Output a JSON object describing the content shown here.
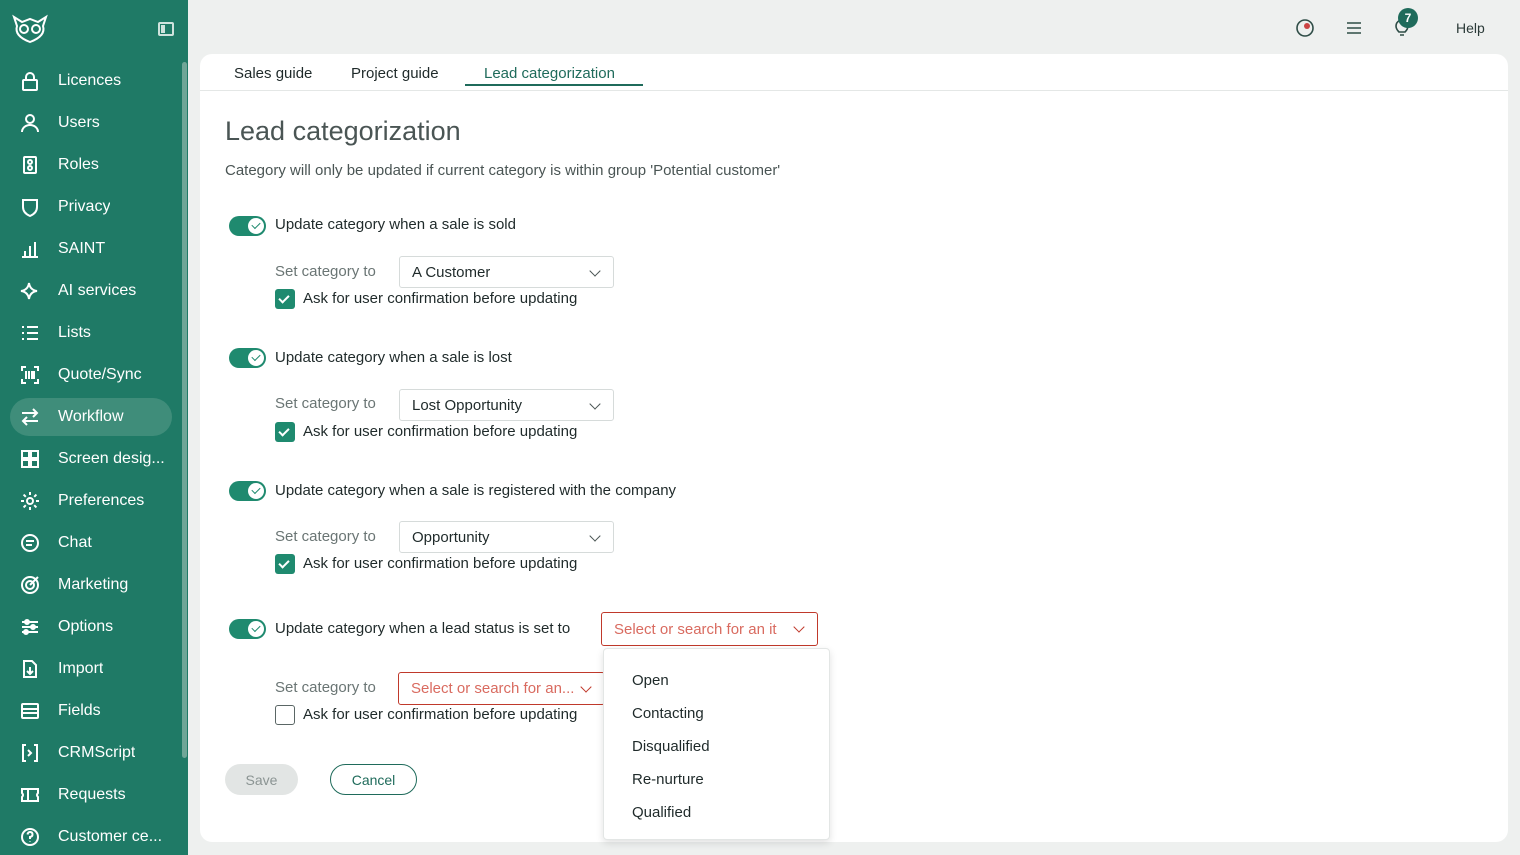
{
  "sidebar": {
    "items": [
      {
        "label": "Licences",
        "icon": "lock-icon"
      },
      {
        "label": "Users",
        "icon": "user-icon"
      },
      {
        "label": "Roles",
        "icon": "roles-icon"
      },
      {
        "label": "Privacy",
        "icon": "shield-icon"
      },
      {
        "label": "SAINT",
        "icon": "bar-chart-icon"
      },
      {
        "label": "AI services",
        "icon": "sparkle-icon"
      },
      {
        "label": "Lists",
        "icon": "list-icon"
      },
      {
        "label": "Quote/Sync",
        "icon": "barcode-icon"
      },
      {
        "label": "Workflow",
        "icon": "arrows-icon",
        "active": true
      },
      {
        "label": "Screen desig...",
        "icon": "grid-icon"
      },
      {
        "label": "Preferences",
        "icon": "gear-icon"
      },
      {
        "label": "Chat",
        "icon": "chat-icon"
      },
      {
        "label": "Marketing",
        "icon": "target-icon"
      },
      {
        "label": "Options",
        "icon": "sliders-icon"
      },
      {
        "label": "Import",
        "icon": "import-icon"
      },
      {
        "label": "Fields",
        "icon": "fields-icon"
      },
      {
        "label": "CRMScript",
        "icon": "script-icon"
      },
      {
        "label": "Requests",
        "icon": "ticket-icon"
      },
      {
        "label": "Customer ce...",
        "icon": "help-circle-icon"
      }
    ]
  },
  "topbar": {
    "notification_count": "7",
    "help_label": "Help"
  },
  "tabs": [
    {
      "label": "Sales guide"
    },
    {
      "label": "Project guide"
    },
    {
      "label": "Lead categorization"
    }
  ],
  "main": {
    "title": "Lead categorization",
    "description": "Category will only be updated if current category is within group 'Potential customer'",
    "rules": [
      {
        "label": "Update category when a sale is sold",
        "set_label": "Set category to",
        "category": "A Customer",
        "confirm_label": "Ask for user confirmation before updating"
      },
      {
        "label": "Update category when a sale is lost",
        "set_label": "Set category to",
        "category": "Lost Opportunity",
        "confirm_label": "Ask for user confirmation before updating"
      },
      {
        "label": "Update category when a sale is registered with the company",
        "set_label": "Set category to",
        "category": "Opportunity",
        "confirm_label": "Ask for user confirmation before updating"
      },
      {
        "label": "Update category when a lead status is set to",
        "status_placeholder": "Select or search for an it",
        "set_label": "Set category to",
        "category_placeholder": "Select or search for an...",
        "confirm_label": "Ask for user confirmation before updating"
      }
    ],
    "save_label": "Save",
    "cancel_label": "Cancel"
  },
  "dropdown": {
    "options": [
      "Open",
      "Contacting",
      "Disqualified",
      "Re-nurture",
      "Qualified"
    ]
  },
  "colors": {
    "sidebar": "#1f7a66",
    "accent": "#1f8a6f",
    "error": "#c0392b"
  }
}
